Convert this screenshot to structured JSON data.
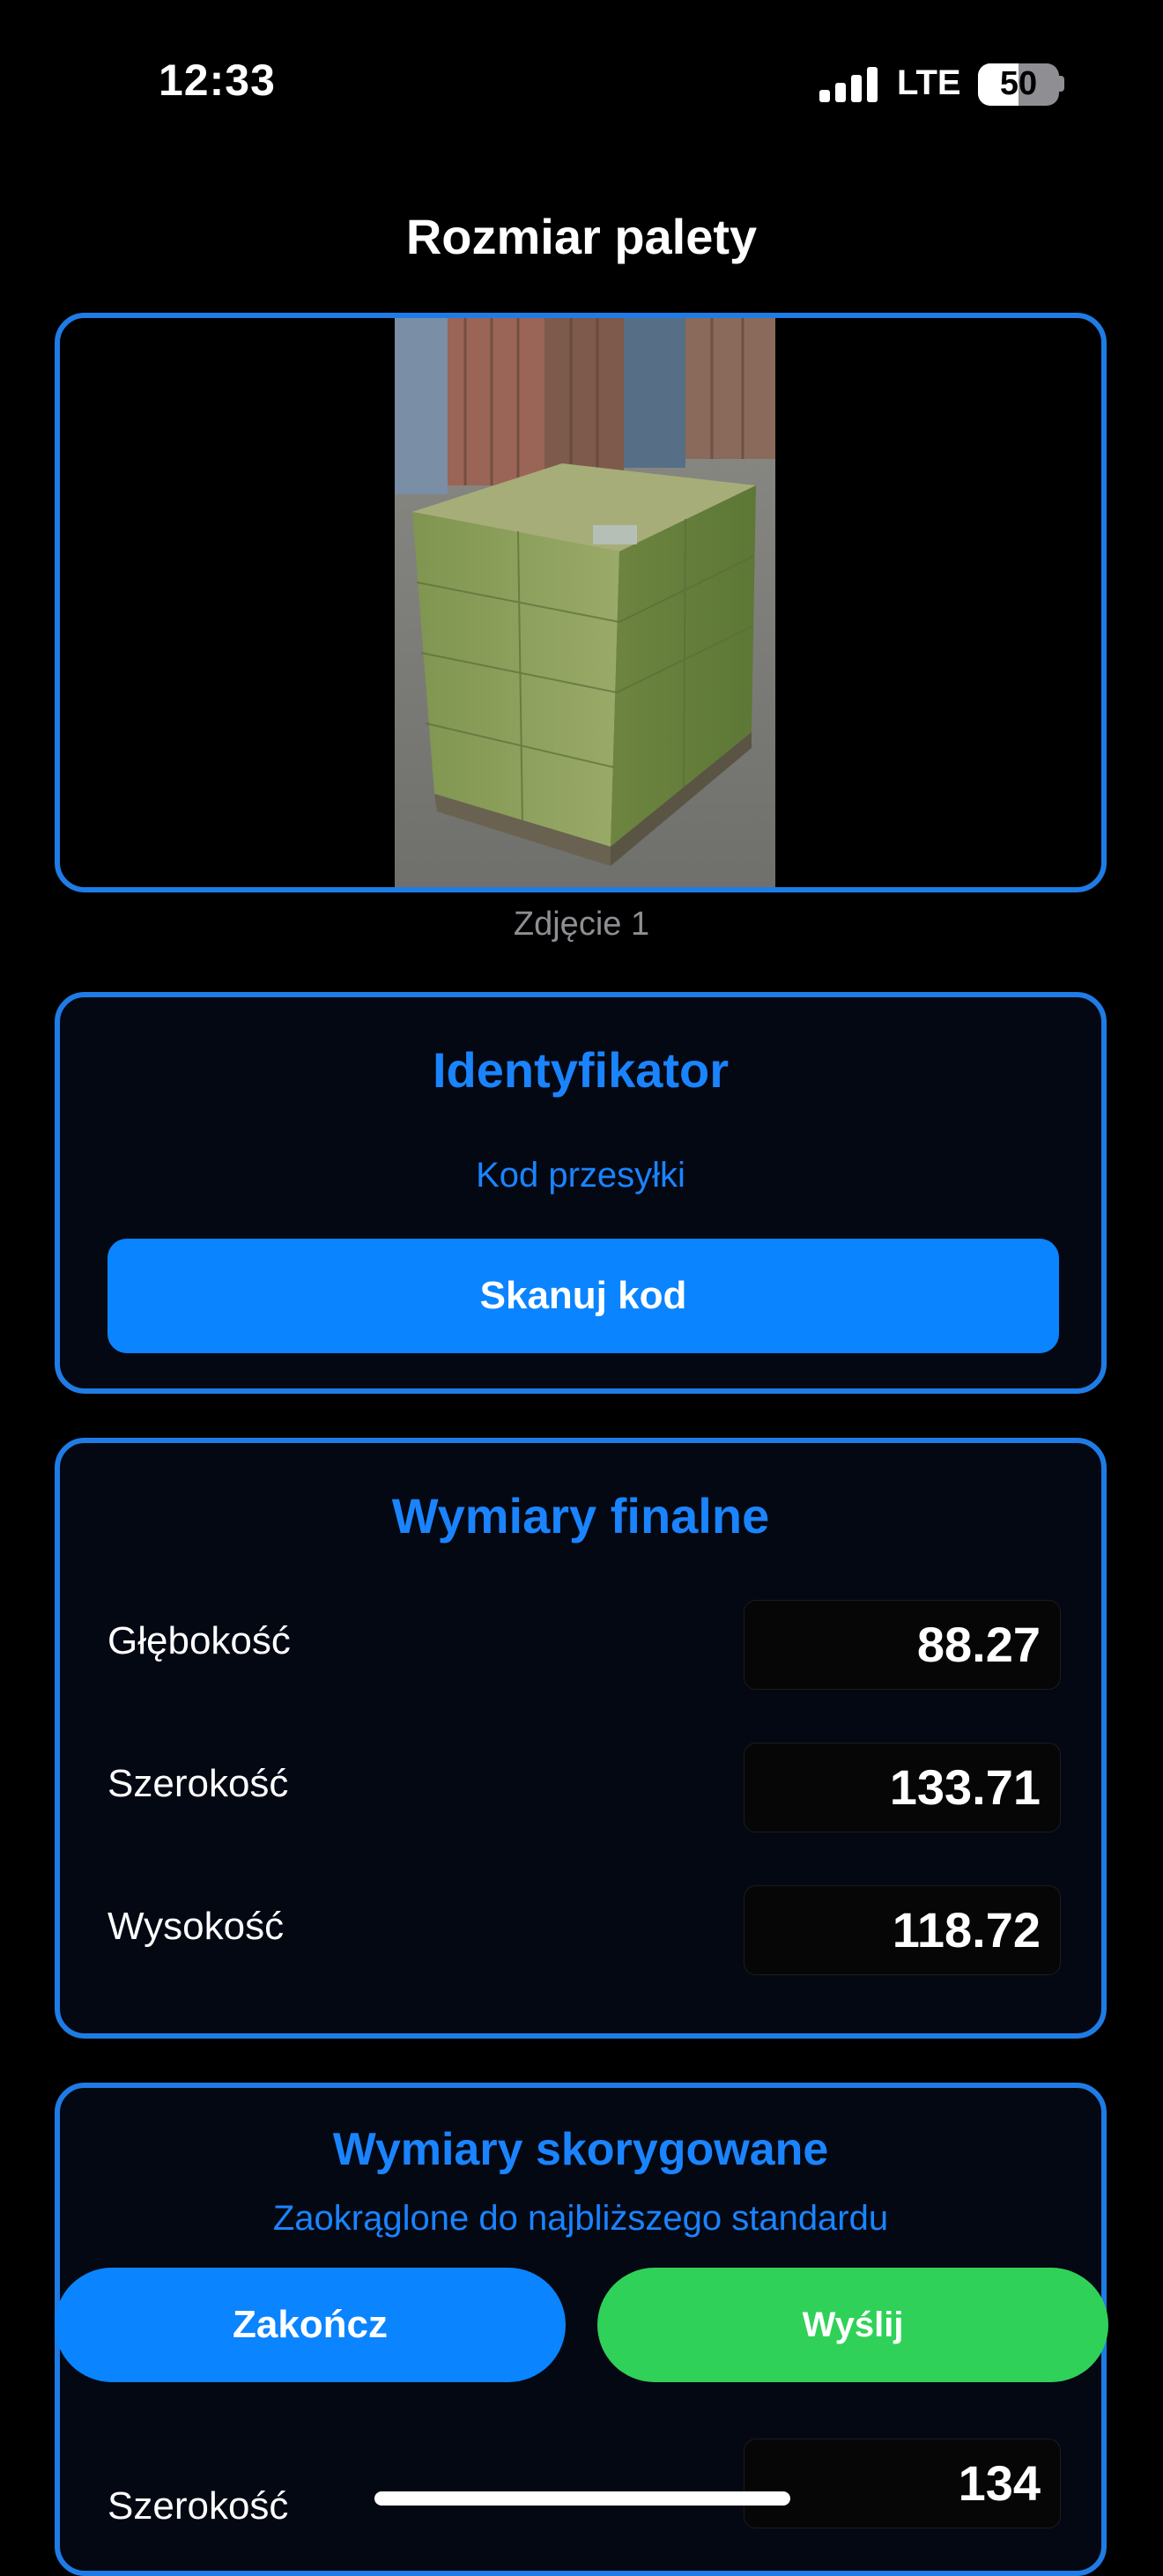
{
  "status_bar": {
    "time": "12:33",
    "network": "LTE",
    "battery": "50",
    "battery_level": 0.5
  },
  "page": {
    "title": "Rozmiar palety"
  },
  "photo": {
    "caption": "Zdjęcie 1"
  },
  "identifier": {
    "title": "Identyfikator",
    "code_label": "Kod przesyłki",
    "scan_button": "Skanuj kod"
  },
  "final_dimensions": {
    "title": "Wymiary finalne",
    "rows": [
      {
        "label": "Głębokość",
        "value": "88.27"
      },
      {
        "label": "Szerokość",
        "value": "133.71"
      },
      {
        "label": "Wysokość",
        "value": "118.72"
      }
    ]
  },
  "corrected_dimensions": {
    "title": "Wymiary skorygowane",
    "subtitle": "Zaokrąglone do najbliższego standardu",
    "rows": [
      {
        "label": "Szerokość",
        "value": "134"
      }
    ]
  },
  "actions": {
    "finish": "Zakończ",
    "send": "Wyślij"
  },
  "colors": {
    "accent": "#0a84ff",
    "border": "#1f7ce6",
    "send": "#30d158",
    "background": "#000000"
  }
}
